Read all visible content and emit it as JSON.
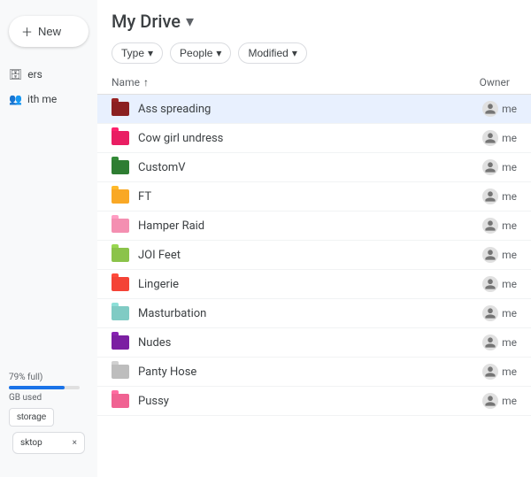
{
  "sidebar": {
    "items": [
      {
        "label": "ers",
        "icon": "drive-icon",
        "active": false
      },
      {
        "label": "ith me",
        "icon": "shared-icon",
        "active": false
      }
    ],
    "storage": {
      "label": "79% full)",
      "used": "GB used",
      "button": "storage"
    },
    "desktop_notif": {
      "label": "sktop",
      "close": "×"
    }
  },
  "header": {
    "title": "My Drive",
    "dropdown_icon": "▾"
  },
  "filters": [
    {
      "label": "Type",
      "has_arrow": true
    },
    {
      "label": "People",
      "has_arrow": true
    },
    {
      "label": "Modified",
      "has_arrow": true
    }
  ],
  "table": {
    "columns": {
      "name": "Name",
      "sort_icon": "↑",
      "owner": "Owner"
    },
    "rows": [
      {
        "name": "Ass spreading",
        "folder_color": "dark-red",
        "owner": "me",
        "selected": true
      },
      {
        "name": "Cow girl undress",
        "folder_color": "pink",
        "owner": "me",
        "selected": false
      },
      {
        "name": "CustomV",
        "folder_color": "green-dark",
        "owner": "me",
        "selected": false
      },
      {
        "name": "FT",
        "folder_color": "yellow",
        "owner": "me",
        "selected": false
      },
      {
        "name": "Hamper Raid",
        "folder_color": "pink-light",
        "owner": "me",
        "selected": false
      },
      {
        "name": "JOI Feet",
        "folder_color": "green-light",
        "owner": "me",
        "selected": false
      },
      {
        "name": "Lingerie",
        "folder_color": "red",
        "owner": "me",
        "selected": false
      },
      {
        "name": "Masturbation",
        "folder_color": "teal",
        "owner": "me",
        "selected": false
      },
      {
        "name": "Nudes",
        "folder_color": "purple",
        "owner": "me",
        "selected": false
      },
      {
        "name": "Panty Hose",
        "folder_color": "gray",
        "owner": "me",
        "selected": false
      },
      {
        "name": "Pussy",
        "folder_color": "pink2",
        "owner": "me",
        "selected": false
      }
    ]
  }
}
